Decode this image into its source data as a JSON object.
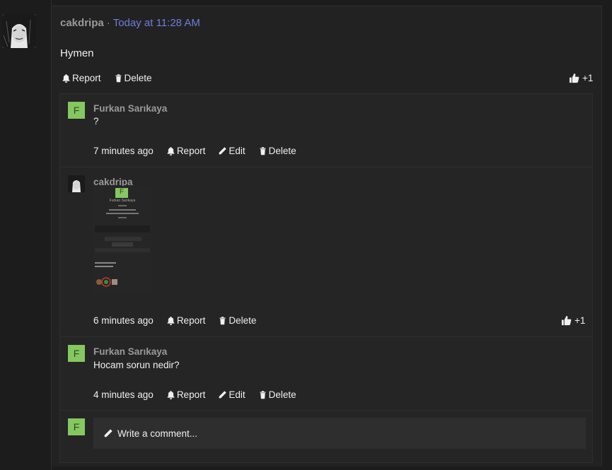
{
  "post": {
    "author": "cakdripa",
    "separator": "·",
    "timestamp": "Today at 11:28 AM",
    "text": "Hymen",
    "actions": {
      "report": "Report",
      "delete": "Delete"
    },
    "likes": "+1"
  },
  "comments": [
    {
      "author": "Furkan Sarıkaya",
      "avatar_letter": "F",
      "text": "?",
      "time": "7 minutes ago",
      "actions": {
        "report": "Report",
        "edit": "Edit",
        "delete": "Delete"
      }
    },
    {
      "author": "cakdripa",
      "time": "6 minutes ago",
      "actions": {
        "report": "Report",
        "delete": "Delete"
      },
      "likes": "+1",
      "attachment": {
        "avatar_letter": "F",
        "name": "Furkan Sarıkaya"
      }
    },
    {
      "author": "Furkan Sarıkaya",
      "avatar_letter": "F",
      "text": "Hocam sorun nedir?",
      "time": "4 minutes ago",
      "actions": {
        "report": "Report",
        "edit": "Edit",
        "delete": "Delete"
      }
    }
  ],
  "composer": {
    "avatar_letter": "F",
    "placeholder": "Write a comment..."
  },
  "colors": {
    "background": "#1c1c1c",
    "panel": "#222222",
    "link": "#6f7ddb",
    "avatar_green": "#85c760",
    "muted_author": "#9a9a9a"
  },
  "icons": [
    "bell-icon",
    "trash-icon",
    "pencil-icon",
    "thumbs-up-icon"
  ]
}
